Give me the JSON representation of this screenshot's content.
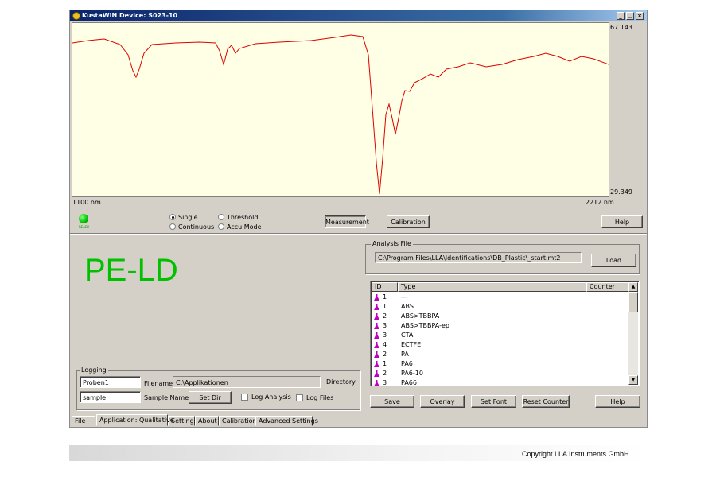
{
  "window": {
    "title": "KustaWIN Device: S023-10",
    "minimize_glyph": "_",
    "maximize_glyph": "□",
    "close_glyph": "×"
  },
  "spectrum": {
    "y_max_label": "67.143",
    "y_min_label": "29.349",
    "x_min_label": "1100 nm",
    "x_max_label": "2212 nm",
    "line_color": "#e00000",
    "background": "#ffffe5"
  },
  "status": {
    "led_color": "#00c000",
    "led_label": "READY"
  },
  "mode": {
    "single": "Single",
    "continuous": "Continuous",
    "threshold": "Threshold",
    "accu_mode": "Accu Mode",
    "selected": "Single"
  },
  "toolbar": {
    "measurement": "Measurement",
    "calibration": "Calibration",
    "help": "Help"
  },
  "result": {
    "text": "PE-LD",
    "color": "#00c000"
  },
  "analysis_file": {
    "group_title": "Analysis File",
    "path": "C:\\Program Files\\LLA\\Identifications\\DB_Plastic\\_start.mt2",
    "load_button": "Load"
  },
  "list": {
    "columns": [
      "ID",
      "Type",
      "Counter"
    ],
    "rows": [
      {
        "id": "1",
        "type": "---"
      },
      {
        "id": "1",
        "type": "ABS"
      },
      {
        "id": "2",
        "type": "ABS>TBBPA"
      },
      {
        "id": "3",
        "type": "ABS>TBBPA-ep"
      },
      {
        "id": "3",
        "type": "CTA"
      },
      {
        "id": "4",
        "type": "ECTFE"
      },
      {
        "id": "2",
        "type": "PA"
      },
      {
        "id": "1",
        "type": "PA6"
      },
      {
        "id": "2",
        "type": "PA6-10"
      },
      {
        "id": "3",
        "type": "PA66"
      }
    ],
    "scroll_up": "▲",
    "scroll_down": "▼",
    "icon_color": "#c000c0"
  },
  "list_buttons": {
    "save": "Save",
    "overlay": "Overlay",
    "set_font": "Set Font",
    "reset_counter": "Reset Counter",
    "help": "Help"
  },
  "logging": {
    "group_title": "Logging",
    "filename_value": "Proben1",
    "filename_label": "Filename",
    "directory_value": "C:\\Applikationen",
    "directory_label": "Directory",
    "sample_value": "sample",
    "sample_label": "Sample Name",
    "set_dir_button": "Set Dir",
    "log_analysis_label": "Log Analysis",
    "log_files_label": "Log Files"
  },
  "tabs": [
    "File",
    "Application: Qualitative",
    "Settings",
    "About",
    "Calibration",
    "Advanced Settings"
  ],
  "active_tab": "Application: Qualitative",
  "footer": {
    "copyright": "Copyright LLA Instruments GmbH"
  }
}
